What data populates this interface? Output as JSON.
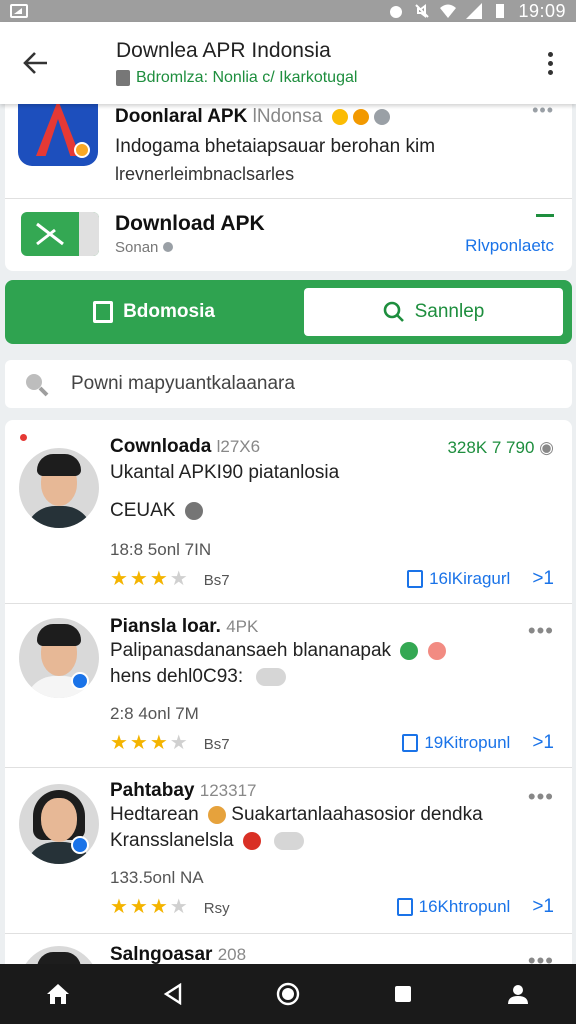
{
  "status_bar": {
    "time": "19:09",
    "icons": [
      "image-icon",
      "alarm-icon",
      "mute-icon",
      "wifi-icon",
      "signal-icon",
      "battery-icon"
    ]
  },
  "app_bar": {
    "title": "Downlea APR Indonsia",
    "subtitle": "Bdromlza: Nonlia c/ Ikarkotugal",
    "back_icon": "arrow-back-icon",
    "menu_icon": "overflow-menu-icon"
  },
  "top_card": {
    "title": "Doonlaral APK",
    "title_light": "lNdonsa",
    "desc1": "Indogama bhetaiapsauar berohan kim",
    "desc2": "lrevnerleimbnaclsarles",
    "dl_title": "Download APK",
    "dl_sub": "Sonan",
    "dl_link": "Rlvponlaetc"
  },
  "tabs": [
    {
      "label": "Bdomosia",
      "icon": "document-icon"
    },
    {
      "label": "Sannlep",
      "icon": "search-icon"
    }
  ],
  "search": {
    "placeholder": "Powni mapyuantkalaanara"
  },
  "items": [
    {
      "name": "Cownloada",
      "name_light": "l27X6",
      "stats": "328K 7 790",
      "line1": "Ukantal APKI90 piatanlosia",
      "line2": "CEUAK",
      "meta": "18:8 5onl 7IN",
      "rating_label": "Bs7",
      "action": "16lKiragurl",
      "action_end": ">1"
    },
    {
      "name": "Piansla loar.",
      "name_light": "4PK",
      "stats": "",
      "line1": "Palipanasdanansaeh blananapak",
      "line2": "hens dehl0C93:",
      "meta": "2:8 4onl 7M",
      "rating_label": "Bs7",
      "action": "19Kitropunl",
      "action_end": ">1"
    },
    {
      "name": "Pahtabay",
      "name_light": "123317",
      "stats": "",
      "line1": "Hedtarean",
      "line1b": "Suakartanlaahasosior dendka",
      "line2": "Kransslanelsla",
      "meta": "133.5onl NA",
      "rating_label": "Rsy",
      "action": "16Khtropunl",
      "action_end": ">1"
    },
    {
      "name": "Salngoasar",
      "name_light": "208"
    }
  ],
  "nav_bar": [
    "home-icon",
    "back-triangle-icon",
    "home-circle-icon",
    "recents-square-icon",
    "account-icon"
  ]
}
